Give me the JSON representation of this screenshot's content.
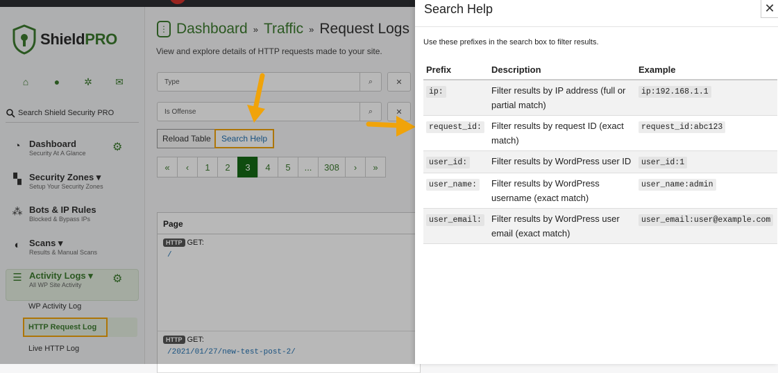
{
  "sidebar": {
    "logo_prefix": "Shield",
    "logo_suffix": "PRO",
    "search_placeholder": "Search Shield Security PRO",
    "nav": [
      {
        "title": "Dashboard",
        "subtitle": "Security At A Glance"
      },
      {
        "title": "Security Zones ▾",
        "subtitle": "Setup Your Security Zones"
      },
      {
        "title": "Bots & IP Rules",
        "subtitle": "Blocked & Bypass IPs"
      },
      {
        "title": "Scans ▾",
        "subtitle": "Results & Manual Scans"
      },
      {
        "title": "Activity Logs ▾",
        "subtitle": "All WP Site Activity"
      }
    ],
    "sub": [
      "WP Activity Log",
      "HTTP Request Log",
      "Live HTTP Log"
    ]
  },
  "main": {
    "breadcrumb": [
      "Dashboard",
      "Traffic",
      "Request Logs"
    ],
    "breadcrumb_sep": "»",
    "lead": "View and explore details of HTTP requests made to your site.",
    "filters": [
      "Type",
      "Is Offense"
    ],
    "reload_label": "Reload Table",
    "help_label": "Search Help",
    "pager": [
      "«",
      "‹",
      "1",
      "2",
      "3",
      "4",
      "5",
      "...",
      "308",
      "›",
      "»"
    ],
    "pager_active": "3",
    "column_page": "Page",
    "rows": [
      {
        "method_badge": "HTTP",
        "method": "GET:",
        "path": "/"
      },
      {
        "method_badge": "HTTP",
        "method": "GET:",
        "path": "/2021/01/27/new-test-post-2/"
      }
    ]
  },
  "help": {
    "title": "Search Help",
    "close": "✕",
    "intro": "Use these prefixes in the search box to filter results.",
    "columns": [
      "Prefix",
      "Description",
      "Example"
    ],
    "rows": [
      {
        "prefix": "ip:",
        "description": "Filter results by IP address (full or partial match)",
        "example": "ip:192.168.1.1"
      },
      {
        "prefix": "request_id:",
        "description": "Filter results by request ID (exact match)",
        "example": "request_id:abc123"
      },
      {
        "prefix": "user_id:",
        "description": "Filter results by WordPress user ID",
        "example": "user_id:1"
      },
      {
        "prefix": "user_name:",
        "description": "Filter results by WordPress username (exact match)",
        "example": "user_name:admin"
      },
      {
        "prefix": "user_email:",
        "description": "Filter results by WordPress user email (exact match)",
        "example": "user_email:user@example.com"
      }
    ]
  },
  "colors": {
    "brand": "#3c7b2f",
    "highlight": "#f0a30a",
    "link": "#2271b1"
  }
}
